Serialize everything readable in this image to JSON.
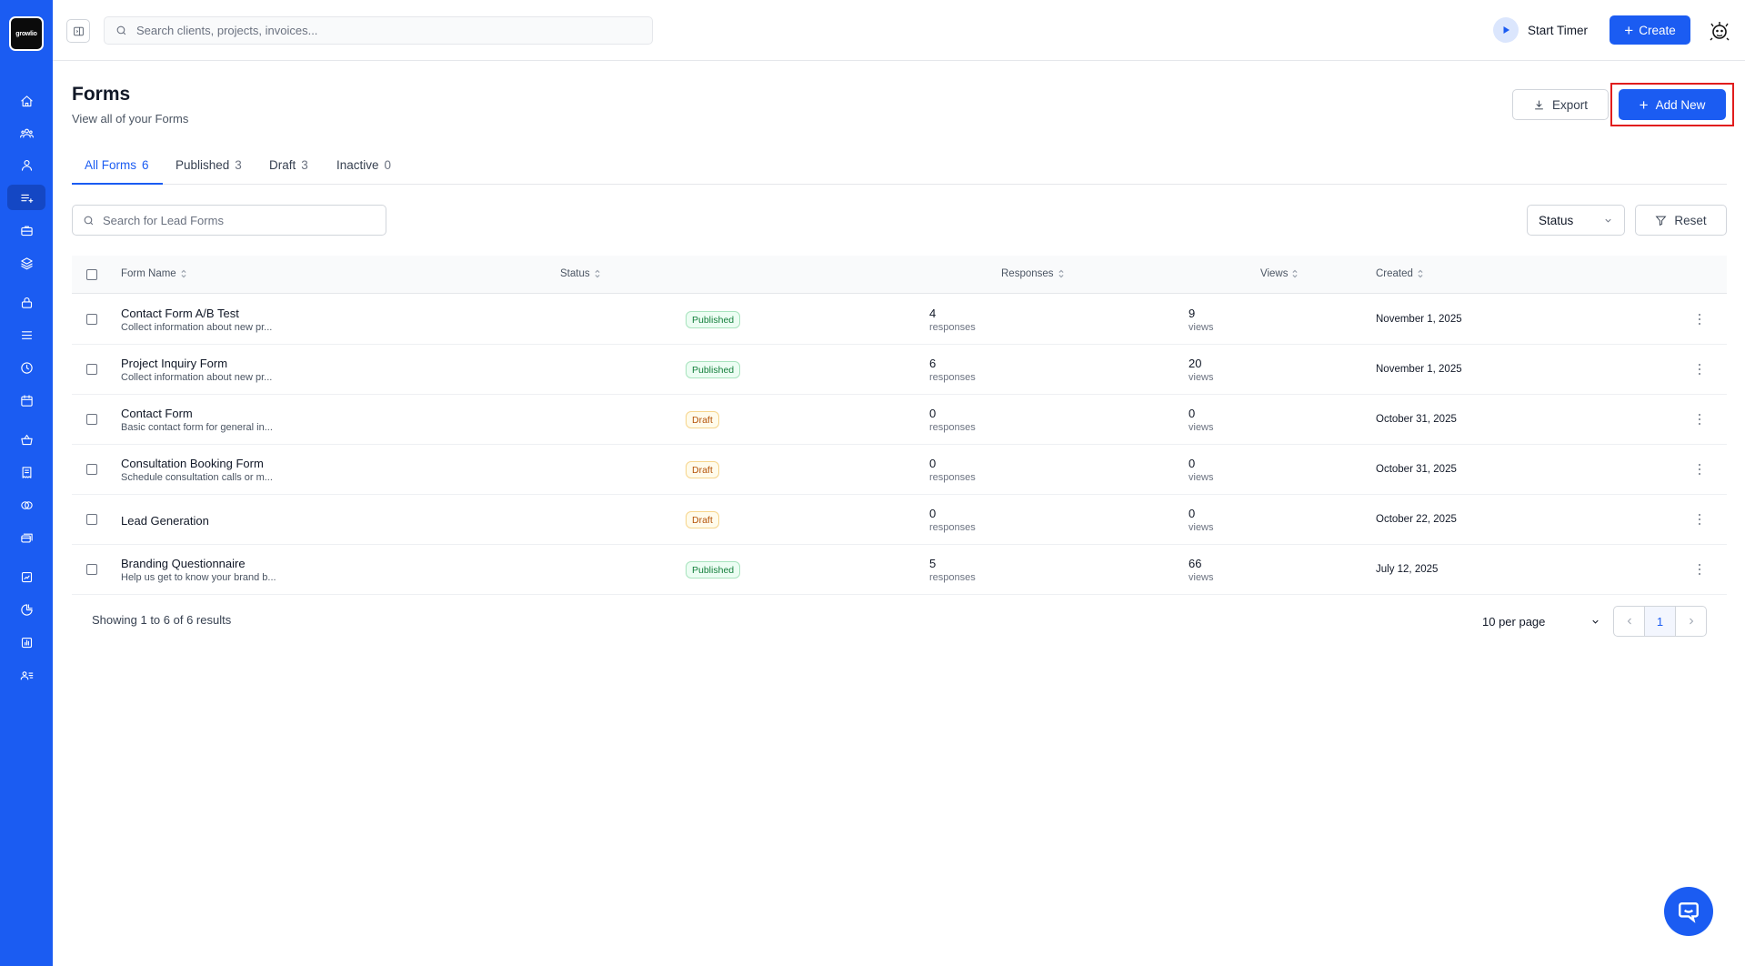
{
  "brand": {
    "logo_text": "growlio",
    "accent": "#1b5cf2"
  },
  "sidebar": {
    "items": [
      {
        "icon": "home-icon"
      },
      {
        "icon": "team-icon"
      },
      {
        "icon": "user-icon"
      },
      {
        "icon": "forms-icon",
        "active": true
      },
      {
        "icon": "briefcase-icon"
      },
      {
        "icon": "layers-icon"
      },
      {
        "icon": "lock-icon"
      },
      {
        "icon": "list-icon"
      },
      {
        "icon": "clock-icon"
      },
      {
        "icon": "calendar-icon"
      },
      {
        "icon": "basket-icon"
      },
      {
        "icon": "receipt-icon"
      },
      {
        "icon": "coins-icon"
      },
      {
        "icon": "cards-icon"
      },
      {
        "icon": "report-icon"
      },
      {
        "icon": "pie-chart-icon"
      },
      {
        "icon": "chart-icon"
      },
      {
        "icon": "contacts-icon"
      }
    ]
  },
  "topbar": {
    "search_placeholder": "Search clients, projects, invoices...",
    "timer_label": "Start Timer",
    "create_label": "Create"
  },
  "page": {
    "title": "Forms",
    "subtitle": "View all of your Forms",
    "export_label": "Export",
    "add_new_label": "Add New"
  },
  "tabs": [
    {
      "label": "All Forms",
      "count": "6",
      "active": true
    },
    {
      "label": "Published",
      "count": "3"
    },
    {
      "label": "Draft",
      "count": "3"
    },
    {
      "label": "Inactive",
      "count": "0"
    }
  ],
  "filters": {
    "search_placeholder": "Search for Lead Forms",
    "status_label": "Status",
    "reset_label": "Reset"
  },
  "table": {
    "columns": [
      "Form Name",
      "Status",
      "Responses",
      "Views",
      "Created"
    ],
    "rows": [
      {
        "name": "Contact Form A/B Test",
        "desc": "Collect information about new pr...",
        "status": "Published",
        "responses": "4",
        "responses_unit": "responses",
        "views": "9",
        "views_unit": "views",
        "created": "November 1, 2025"
      },
      {
        "name": "Project Inquiry Form",
        "desc": "Collect information about new pr...",
        "status": "Published",
        "responses": "6",
        "responses_unit": "responses",
        "views": "20",
        "views_unit": "views",
        "created": "November 1, 2025"
      },
      {
        "name": "Contact Form",
        "desc": "Basic contact form for general in...",
        "status": "Draft",
        "responses": "0",
        "responses_unit": "responses",
        "views": "0",
        "views_unit": "views",
        "created": "October 31, 2025"
      },
      {
        "name": "Consultation Booking Form",
        "desc": "Schedule consultation calls or m...",
        "status": "Draft",
        "responses": "0",
        "responses_unit": "responses",
        "views": "0",
        "views_unit": "views",
        "created": "October 31, 2025"
      },
      {
        "name": "Lead Generation",
        "desc": "",
        "status": "Draft",
        "responses": "0",
        "responses_unit": "responses",
        "views": "0",
        "views_unit": "views",
        "created": "October 22, 2025"
      },
      {
        "name": "Branding Questionnaire",
        "desc": "Help us get to know your brand b...",
        "status": "Published",
        "responses": "5",
        "responses_unit": "responses",
        "views": "66",
        "views_unit": "views",
        "created": "July 12, 2025"
      }
    ]
  },
  "footer": {
    "showing_text": "Showing 1 to 6 of 6 results",
    "per_page": "10 per page",
    "current_page": "1"
  }
}
